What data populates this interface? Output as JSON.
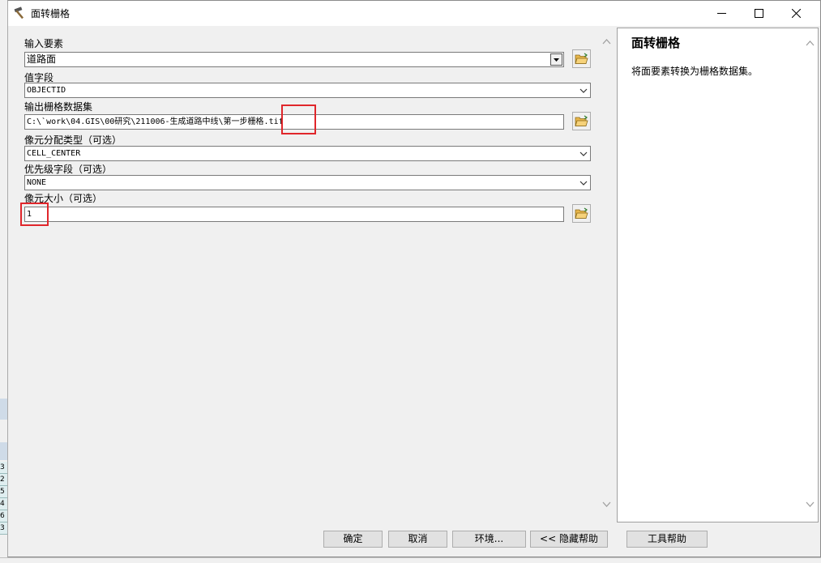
{
  "window": {
    "title": "面转栅格",
    "icon": "hammer-icon"
  },
  "params": {
    "input_features": {
      "label": "输入要素",
      "value": "道路面"
    },
    "value_field": {
      "label": "值字段",
      "value": "OBJECTID"
    },
    "output_raster": {
      "label": "输出栅格数据集",
      "value": "C:\\`work\\04.GIS\\00研究\\211006-生成道路中线\\第一步栅格.tif"
    },
    "cell_assignment": {
      "label": "像元分配类型（可选）",
      "value": "CELL_CENTER"
    },
    "priority_field": {
      "label": "优先级字段（可选）",
      "value": "NONE"
    },
    "cell_size": {
      "label": "像元大小（可选）",
      "value": "1"
    }
  },
  "help": {
    "title": "面转栅格",
    "description": "将面要素转换为栅格数据集。"
  },
  "buttons": {
    "ok": "确定",
    "cancel": "取消",
    "environments": "环境...",
    "hide_help": "<< 隐藏帮助",
    "tool_help": "工具帮助"
  },
  "background": {
    "rows": [
      "3",
      "2",
      "5",
      "4",
      "6",
      "3"
    ]
  },
  "colors": {
    "highlight": "#e0262b",
    "folder": "#e8b64a"
  }
}
